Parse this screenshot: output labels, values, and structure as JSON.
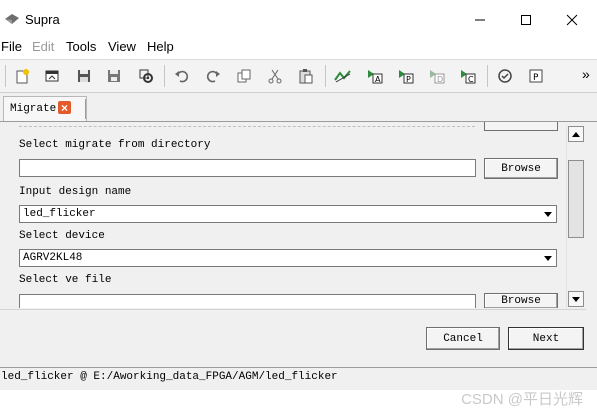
{
  "window": {
    "title": "Supra"
  },
  "menu": [
    {
      "label": "File",
      "enabled": true
    },
    {
      "label": "Edit",
      "enabled": false
    },
    {
      "label": "Tools",
      "enabled": true
    },
    {
      "label": "View",
      "enabled": true
    },
    {
      "label": "Help",
      "enabled": true
    }
  ],
  "toolbar": {
    "icons": [
      "new-project-icon",
      "open-icon",
      "save-icon",
      "save-as-icon",
      "settings-icon",
      "undo-icon",
      "redo-icon",
      "copy-icon",
      "cut-icon",
      "paste-icon",
      "analyze-icon",
      "run-a-icon",
      "run-p-icon",
      "run-d-icon",
      "run-c-icon",
      "check-icon",
      "program-icon"
    ],
    "overflow": "»"
  },
  "tab": {
    "label": "Migrate",
    "close_glyph": "×"
  },
  "form": {
    "migrate_label": "Select migrate from directory",
    "migrate_value": "",
    "browse_label": "Browse",
    "design_label": "Input design name",
    "design_value": "led_flicker",
    "device_label": "Select device",
    "device_value": "AGRV2KL48",
    "ve_label": "Select ve file",
    "ve_value": "",
    "browse2_label": "Browse",
    "cancel_label": "Cancel",
    "next_label": "Next"
  },
  "status": {
    "text": "led_flicker @ E:/Aworking_data_FPGA/AGM/led_flicker"
  },
  "watermark": "CSDN @平日光辉",
  "colors": {
    "close_tab": "#e35b2c",
    "panel_bg": "#f0f0f0",
    "toolbar_green": "#2e8b3e"
  }
}
